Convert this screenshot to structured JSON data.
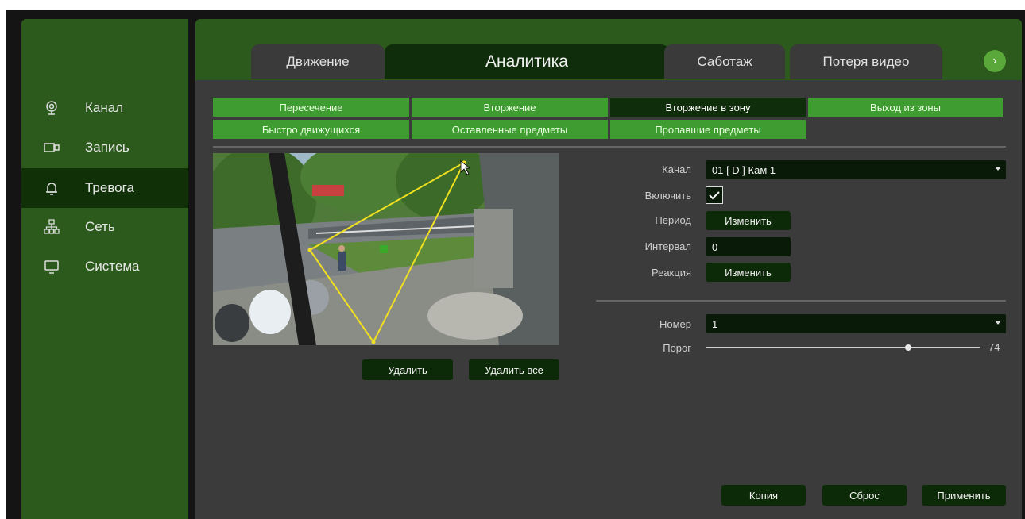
{
  "top_fragment_text": "",
  "sidebar": {
    "items": [
      {
        "label": "Канал",
        "icon": "camera-icon",
        "active": false
      },
      {
        "label": "Запись",
        "icon": "video-icon",
        "active": false
      },
      {
        "label": "Тревога",
        "icon": "bell-icon",
        "active": true
      },
      {
        "label": "Сеть",
        "icon": "network-icon",
        "active": false
      },
      {
        "label": "Система",
        "icon": "monitor-icon",
        "active": false
      }
    ]
  },
  "tabs": [
    {
      "label": "Движение",
      "active": false
    },
    {
      "label": "Аналитика",
      "active": true
    },
    {
      "label": "Саботаж",
      "active": false
    },
    {
      "label": "Потеря видео",
      "active": false
    }
  ],
  "next_icon": "chevron-right-icon",
  "subtabs": [
    {
      "label": "Пересечение",
      "active": false
    },
    {
      "label": "Вторжение",
      "active": false
    },
    {
      "label": "Вторжение в зону",
      "active": true
    },
    {
      "label": "Выход из зоны",
      "active": false
    },
    {
      "label": "Быстро движущихся",
      "active": false
    },
    {
      "label": "Оставленные предметы",
      "active": false
    },
    {
      "label": "Пропавшие предметы",
      "active": false
    }
  ],
  "camera": {
    "delete_label": "Удалить",
    "delete_all_label": "Удалить все"
  },
  "settings": {
    "channel_label": "Канал",
    "channel_value": "01 [ D ] Кам 1",
    "enable_label": "Включить",
    "enable_checked": true,
    "period_label": "Период",
    "period_button": "Изменить",
    "interval_label": "Интервал",
    "interval_value": "0",
    "reaction_label": "Реакция",
    "reaction_button": "Изменить",
    "number_label": "Номер",
    "number_value": "1",
    "threshold_label": "Порог",
    "threshold_value": "74"
  },
  "footer": {
    "copy_label": "Копия",
    "reset_label": "Сброс",
    "apply_label": "Применить"
  },
  "colors": {
    "sidebar_green": "#2c5a1c",
    "active_dark_green": "#0f2d0a",
    "subtab_green": "#3f9c30",
    "content_gray": "#3b3b3b",
    "zone_line": "#f0e020"
  }
}
